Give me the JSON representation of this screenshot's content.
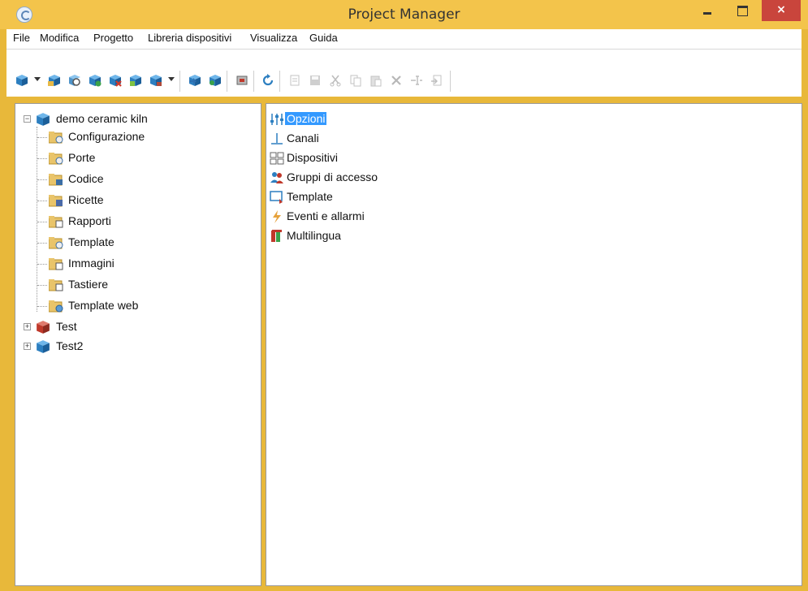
{
  "window": {
    "title": "Project Manager",
    "close_glyph": "×"
  },
  "menu": [
    "File",
    "Modifica",
    "Progetto",
    "Libreria dispositivi",
    "Visualizza",
    "Guida"
  ],
  "toolbar": {
    "icons": [
      "new-project-icon",
      "open-project-icon",
      "search-project-icon",
      "add-project-icon",
      "delete-project-icon",
      "properties-icon",
      "more-project-icon",
      "download-icon",
      "upload-icon",
      "device-icon",
      "refresh-icon",
      "new-icon",
      "save-icon",
      "cut-icon",
      "copy-icon",
      "paste-icon",
      "delete-icon",
      "rename-icon",
      "import-icon"
    ]
  },
  "tree": {
    "root": {
      "label": "demo ceramic kiln",
      "expanded": true
    },
    "children": [
      "Configurazione",
      "Porte",
      "Codice",
      "Ricette",
      "Rapporti",
      "Template",
      "Immagini",
      "Tastiere",
      "Template web"
    ],
    "others": [
      {
        "label": "Test",
        "expanded": false,
        "color": "#c0392b"
      },
      {
        "label": "Test2",
        "expanded": false,
        "color": "#2d8fd5"
      }
    ]
  },
  "list": {
    "items": [
      "Opzioni",
      "Canali",
      "Dispositivi",
      "Gruppi di accesso",
      "Template",
      "Eventi e allarmi",
      "Multilingua"
    ],
    "selected_index": 0
  },
  "colors": {
    "accent": "#f3c44b",
    "selection": "#3399ff",
    "close": "#c9453c"
  }
}
